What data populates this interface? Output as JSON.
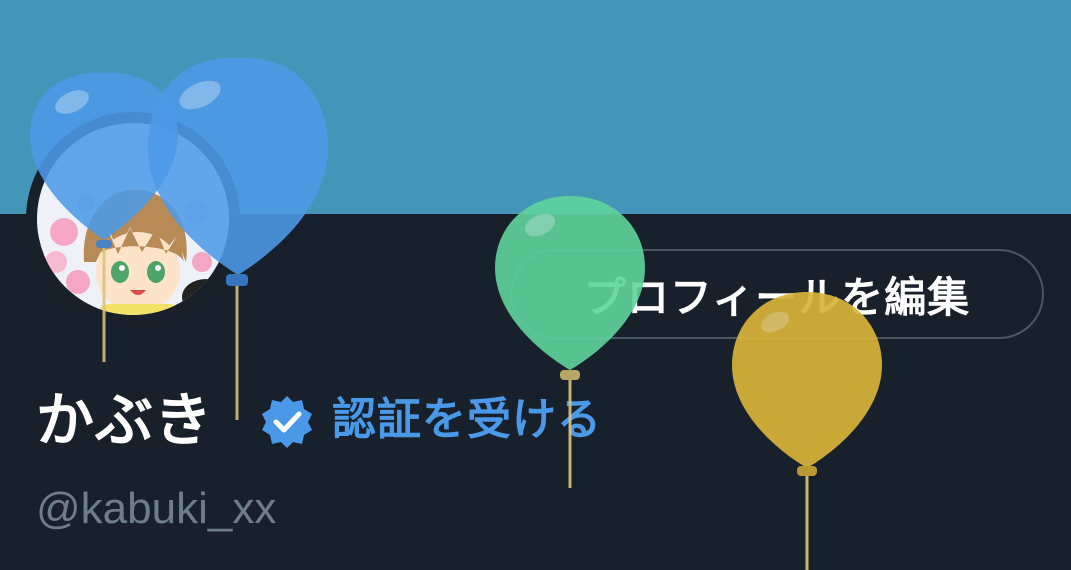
{
  "profile": {
    "display_name": "かぶき",
    "username": "@kabuki_xx",
    "get_verified_label": "認証を受ける",
    "edit_profile_label": "プロフィールを編集"
  },
  "colors": {
    "banner": "#4396b7",
    "background": "#18202b",
    "accent": "#4a99e9",
    "muted_text": "#6e7d8c",
    "button_border": "#475766",
    "balloon_blue": "#4d9ae8",
    "balloon_green": "#5fd49c",
    "balloon_yellow": "#d9b43a"
  },
  "icons": {
    "verified": "verified-badge-icon",
    "balloons": "birthday-balloon-icon"
  }
}
